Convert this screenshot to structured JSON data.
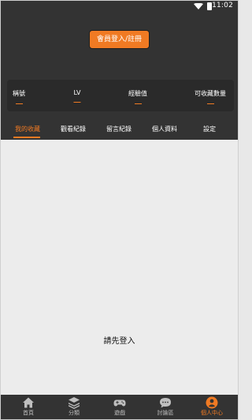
{
  "status_bar": {
    "time": "11:02"
  },
  "header": {
    "login_button": "會員登入/註冊"
  },
  "stats": [
    {
      "label": "稱號"
    },
    {
      "label": "LV"
    },
    {
      "label": "經驗值"
    },
    {
      "label": "可收藏數量"
    }
  ],
  "tabs": [
    {
      "label": "我的收藏",
      "active": true
    },
    {
      "label": "觀看紀錄"
    },
    {
      "label": "留言紀錄"
    },
    {
      "label": "個人資料"
    },
    {
      "label": "設定"
    }
  ],
  "content": {
    "empty_message": "請先登入"
  },
  "bottom_nav": [
    {
      "label": "首頁",
      "icon": "home-icon"
    },
    {
      "label": "分類",
      "icon": "layers-icon"
    },
    {
      "label": "遊戲",
      "icon": "gamepad-icon"
    },
    {
      "label": "討論區",
      "icon": "chat-icon"
    },
    {
      "label": "個人中心",
      "icon": "user-icon",
      "active": true
    }
  ],
  "colors": {
    "accent": "#f07a23",
    "dark": "#333333",
    "background": "#ececec"
  }
}
